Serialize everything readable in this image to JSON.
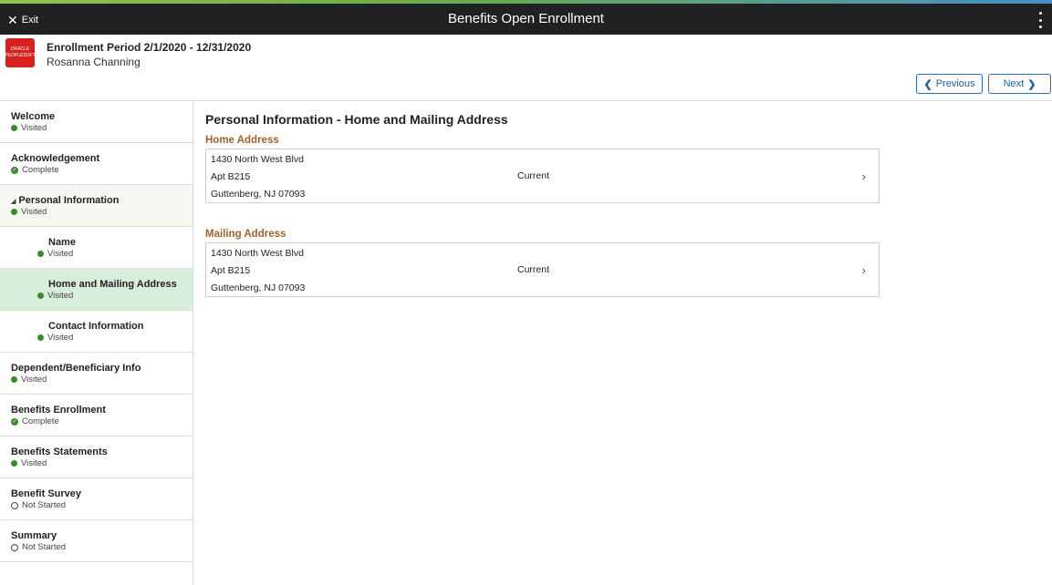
{
  "app": {
    "title": "Benefits Open Enrollment",
    "exit_label": "Exit",
    "exit_icon": "✕"
  },
  "header": {
    "logo_line1": "ORACLE",
    "logo_line2": "PEOPLESOFT",
    "enrollment_period": "Enrollment Period 2/1/2020 - 12/31/2020",
    "person_name": "Rosanna Channing",
    "previous_label": "Previous",
    "next_label": "Next"
  },
  "sidebar": {
    "items": [
      {
        "label": "Welcome",
        "status": "Visited"
      },
      {
        "label": "Acknowledgement",
        "status": "Complete"
      },
      {
        "label": "Personal Information",
        "status": "Visited"
      },
      {
        "label": "Name",
        "status": "Visited"
      },
      {
        "label": "Home and Mailing Address",
        "status": "Visited"
      },
      {
        "label": "Contact Information",
        "status": "Visited"
      },
      {
        "label": "Dependent/Beneficiary Info",
        "status": "Visited"
      },
      {
        "label": "Benefits Enrollment",
        "status": "Complete"
      },
      {
        "label": "Benefits Statements",
        "status": "Visited"
      },
      {
        "label": "Benefit Survey",
        "status": "Not Started"
      },
      {
        "label": "Summary",
        "status": "Not Started"
      }
    ]
  },
  "main": {
    "page_title": "Personal Information - Home and Mailing Address",
    "home": {
      "label": "Home Address",
      "line1": "1430 North West Blvd",
      "line2": "Apt B215",
      "line3": "Guttenberg, NJ 07093",
      "status": "Current"
    },
    "mailing": {
      "label": "Mailing Address",
      "line1": "1430 North West Blvd",
      "line2": "Apt B215",
      "line3": "Guttenberg, NJ 07093",
      "status": "Current"
    }
  },
  "colors": {
    "topbar": "#1f2123",
    "accent_green": "#6aa84f",
    "accent_blue": "#4a90c8",
    "selected_bg": "#d7eedd",
    "status_green": "#3a8a2e",
    "section_label": "#a0622a",
    "button_blue": "#1f5fa8"
  }
}
